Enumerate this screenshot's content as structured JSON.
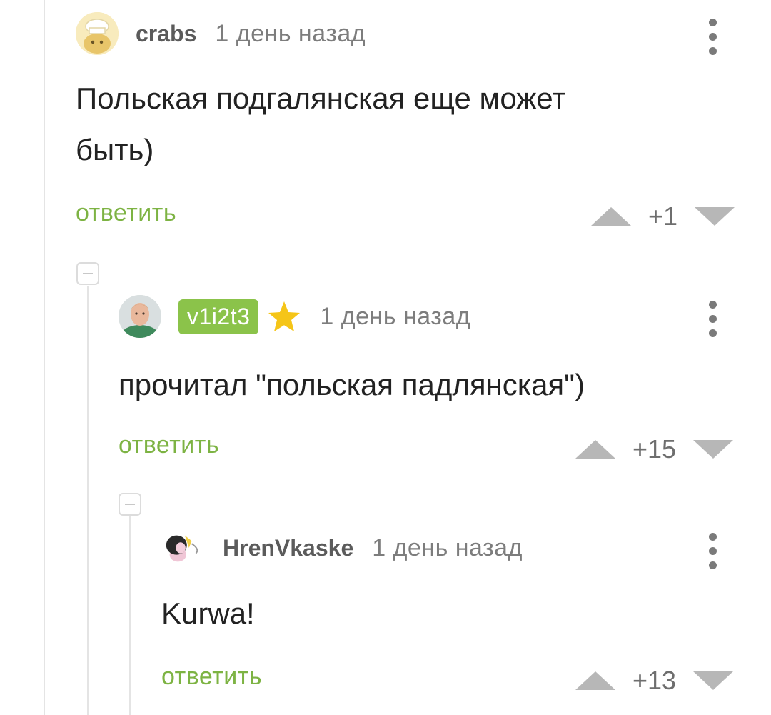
{
  "comments": [
    {
      "username": "crabs",
      "time": "1 день назад",
      "text_line1": "Польская подгалянская еще может",
      "text_line2": "быть)",
      "reply_label": "ответить",
      "rating": "+1",
      "avatar_icon": "chef-avatar-icon"
    },
    {
      "username": "v1i2t3",
      "time": "1 день назад",
      "text": "прочитал \"польская падлянская\")",
      "reply_label": "ответить",
      "rating": "+15",
      "badge_color": "#8bc34a",
      "star_color": "#f5c518",
      "avatar_icon": "user-photo-avatar-icon"
    },
    {
      "username": "HrenVkaske",
      "time": "1 день назад",
      "text": "Kurwa!",
      "reply_label": "ответить",
      "rating": "+13",
      "avatar_icon": "cartoon-avatar-icon"
    }
  ],
  "accent_color": "#7db343"
}
